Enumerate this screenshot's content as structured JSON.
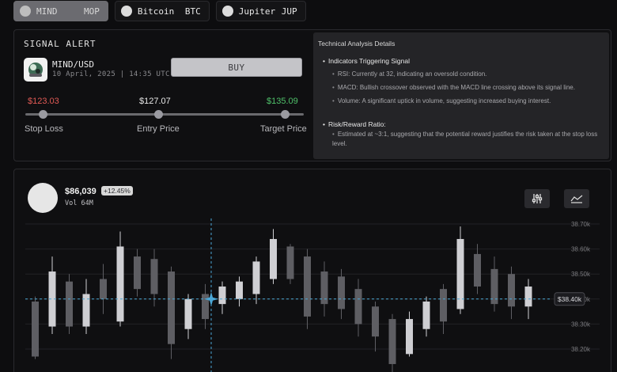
{
  "tabs": [
    {
      "name": "MIND",
      "symbol": "MOP",
      "active": true
    },
    {
      "name": "Bitcoin",
      "symbol": "BTC",
      "active": false
    },
    {
      "name": "Jupiter",
      "symbol": "JUP",
      "active": false
    }
  ],
  "signal": {
    "title": "SIGNAL ALERT",
    "pair": "MIND/USD",
    "datetime": "10 April, 2025 | 14:35 UTC",
    "buy_label": "BUY",
    "stop_loss": {
      "value": "$123.03",
      "label": "Stop Loss"
    },
    "entry": {
      "value": "$127.07",
      "label": "Entry Price"
    },
    "target": {
      "value": "$135.09",
      "label": "Target Price"
    },
    "colors": {
      "stop": "#e05a55",
      "target": "#4fc16a"
    }
  },
  "analysis": {
    "title": "Technical Analysis Details",
    "indicators_heading": "Indicators Triggering Signal",
    "indicators": [
      "RSI: Currently at 32, indicating an oversold condition.",
      "MACD: Bullish crossover observed with the MACD line crossing above its signal line.",
      "Volume: A significant uptick in volume, suggesting increased buying interest."
    ],
    "risk_heading": "Risk/Reward Ratio:",
    "risk_text": "Estimated at ~3:1, suggesting that the potential reward justifies the risk taken at the stop loss level."
  },
  "market": {
    "price": "$86,039",
    "change": "+12.45%",
    "volume": "Vol 64M",
    "icons": [
      "sliders-icon",
      "area-chart-icon"
    ]
  },
  "chart_data": {
    "type": "candlestick",
    "y_ticks": [
      "38.70k",
      "38.60k",
      "38.50k",
      "38.40k",
      "38.30k",
      "38.20k"
    ],
    "current_label": "$38.40k",
    "current_value": 38400,
    "ylim": [
      38200,
      38700
    ],
    "candles": [
      {
        "o": 38390,
        "c": 38170,
        "h": 38410,
        "l": 38160
      },
      {
        "o": 38290,
        "c": 38510,
        "h": 38570,
        "l": 38260
      },
      {
        "o": 38470,
        "c": 38290,
        "h": 38500,
        "l": 38260
      },
      {
        "o": 38290,
        "c": 38420,
        "h": 38480,
        "l": 38260
      },
      {
        "o": 38480,
        "c": 38400,
        "h": 38540,
        "l": 38340
      },
      {
        "o": 38310,
        "c": 38610,
        "h": 38670,
        "l": 38290
      },
      {
        "o": 38570,
        "c": 38440,
        "h": 38600,
        "l": 38410
      },
      {
        "o": 38560,
        "c": 38420,
        "h": 38600,
        "l": 38370
      },
      {
        "o": 38510,
        "c": 38220,
        "h": 38530,
        "l": 38160
      },
      {
        "o": 38280,
        "c": 38400,
        "h": 38420,
        "l": 38240
      },
      {
        "o": 38420,
        "c": 38320,
        "h": 38460,
        "l": 38280
      },
      {
        "o": 38380,
        "c": 38450,
        "h": 38470,
        "l": 38340
      },
      {
        "o": 38400,
        "c": 38470,
        "h": 38490,
        "l": 38370
      },
      {
        "o": 38420,
        "c": 38550,
        "h": 38570,
        "l": 38380
      },
      {
        "o": 38480,
        "c": 38640,
        "h": 38680,
        "l": 38460
      },
      {
        "o": 38610,
        "c": 38480,
        "h": 38620,
        "l": 38460
      },
      {
        "o": 38570,
        "c": 38330,
        "h": 38600,
        "l": 38280
      },
      {
        "o": 38510,
        "c": 38380,
        "h": 38550,
        "l": 38330
      },
      {
        "o": 38490,
        "c": 38360,
        "h": 38520,
        "l": 38320
      },
      {
        "o": 38440,
        "c": 38300,
        "h": 38480,
        "l": 38250
      },
      {
        "o": 38370,
        "c": 38250,
        "h": 38390,
        "l": 38190
      },
      {
        "o": 38320,
        "c": 38140,
        "h": 38340,
        "l": 38100
      },
      {
        "o": 38180,
        "c": 38320,
        "h": 38350,
        "l": 38170
      },
      {
        "o": 38280,
        "c": 38390,
        "h": 38410,
        "l": 38250
      },
      {
        "o": 38440,
        "c": 38310,
        "h": 38460,
        "l": 38260
      },
      {
        "o": 38360,
        "c": 38640,
        "h": 38690,
        "l": 38340
      },
      {
        "o": 38580,
        "c": 38450,
        "h": 38620,
        "l": 38420
      },
      {
        "o": 38520,
        "c": 38380,
        "h": 38570,
        "l": 38350
      },
      {
        "o": 38500,
        "c": 38370,
        "h": 38530,
        "l": 38320
      },
      {
        "o": 38370,
        "c": 38450,
        "h": 38480,
        "l": 38320
      }
    ]
  }
}
